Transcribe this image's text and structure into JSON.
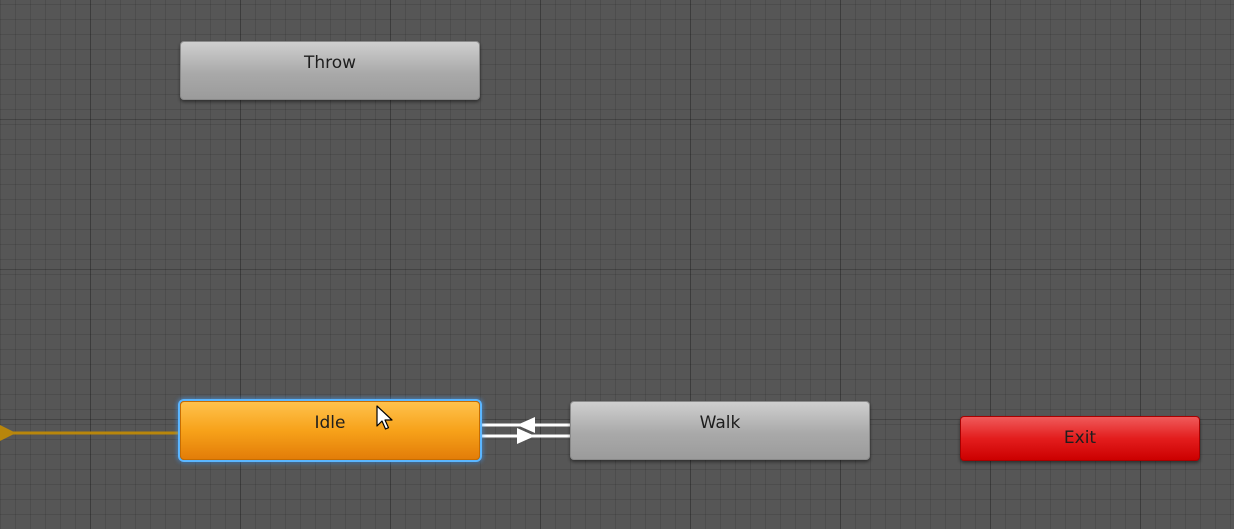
{
  "states": {
    "throw": {
      "label": "Throw"
    },
    "idle": {
      "label": "Idle",
      "is_default": true,
      "selected": true
    },
    "walk": {
      "label": "Walk"
    },
    "exit": {
      "label": "Exit"
    }
  },
  "transitions": [
    {
      "from": "entry",
      "to": "idle"
    },
    {
      "from": "walk",
      "to": "idle"
    },
    {
      "from": "idle",
      "to": "walk"
    }
  ],
  "colors": {
    "canvas": "#565656",
    "state_default": "#a9a9a9",
    "state_entry_default": "#f7a21a",
    "state_exit": "#e31d1d",
    "selection_outline": "#5bb6ff",
    "entry_transition": "#b8860b",
    "transition": "#ffffff"
  },
  "icons": {
    "cursor": "mouse-pointer-icon"
  }
}
